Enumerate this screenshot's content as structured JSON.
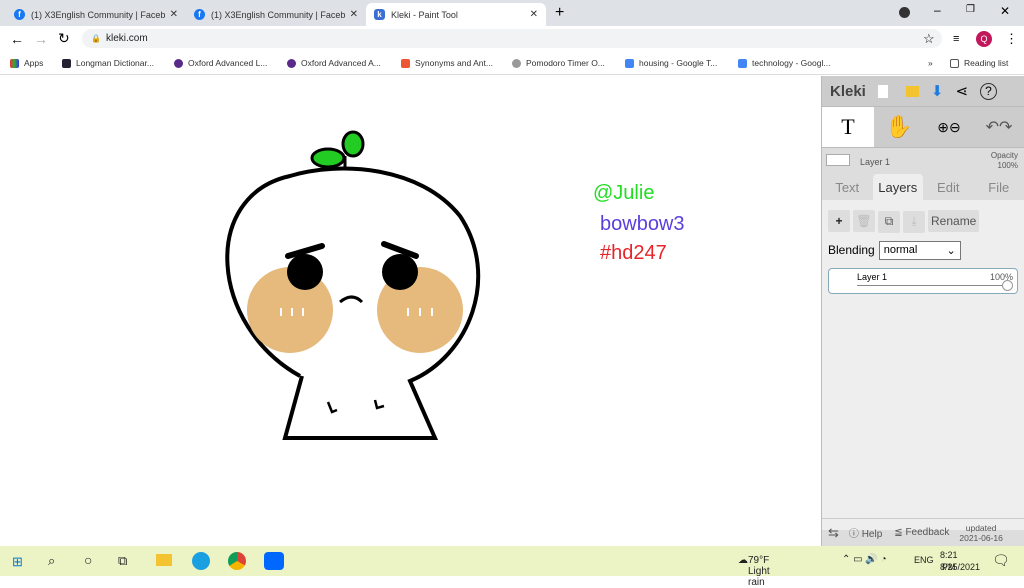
{
  "browser": {
    "tabs": [
      {
        "title": "(1) X3English Community | Faceb"
      },
      {
        "title": "(1) X3English Community | Faceb"
      },
      {
        "title": "Kleki - Paint Tool",
        "active": true
      }
    ],
    "url": "kleki.com",
    "profile_initial": "Q",
    "bookmarks": [
      "Apps",
      "Longman Dictionar...",
      "Oxford Advanced L...",
      "Oxford Advanced A...",
      "Synonyms and Ant...",
      "Pomodoro Timer O...",
      "housing - Google T...",
      "technology - Googl..."
    ],
    "reading_list": "Reading list"
  },
  "canvas": {
    "texts": [
      {
        "text": "@Julie",
        "color": "#22dd22"
      },
      {
        "text": "bowbow3",
        "color": "#5a3fdc"
      },
      {
        "text": "#hd247",
        "color": "#e8242a"
      }
    ]
  },
  "panel": {
    "logo": "Kleki",
    "tool_glyph": "T",
    "layer_name": "Layer 1",
    "opacity_label": "Opacity",
    "opacity_value": "100%",
    "tabs": [
      "Text",
      "Layers",
      "Edit",
      "File"
    ],
    "active_tab": "Layers",
    "rename": "Rename",
    "blending_label": "Blending",
    "blending_value": "normal",
    "layer_item": {
      "name": "Layer 1",
      "opacity": "100%"
    },
    "help": "Help",
    "feedback": "Feedback",
    "updated": "updated",
    "updated_date": "2021-06-16"
  },
  "taskbar": {
    "weather": "79°F  Light rain",
    "lang": "ENG",
    "time": "8:21 PM",
    "date": "8/25/2021"
  }
}
